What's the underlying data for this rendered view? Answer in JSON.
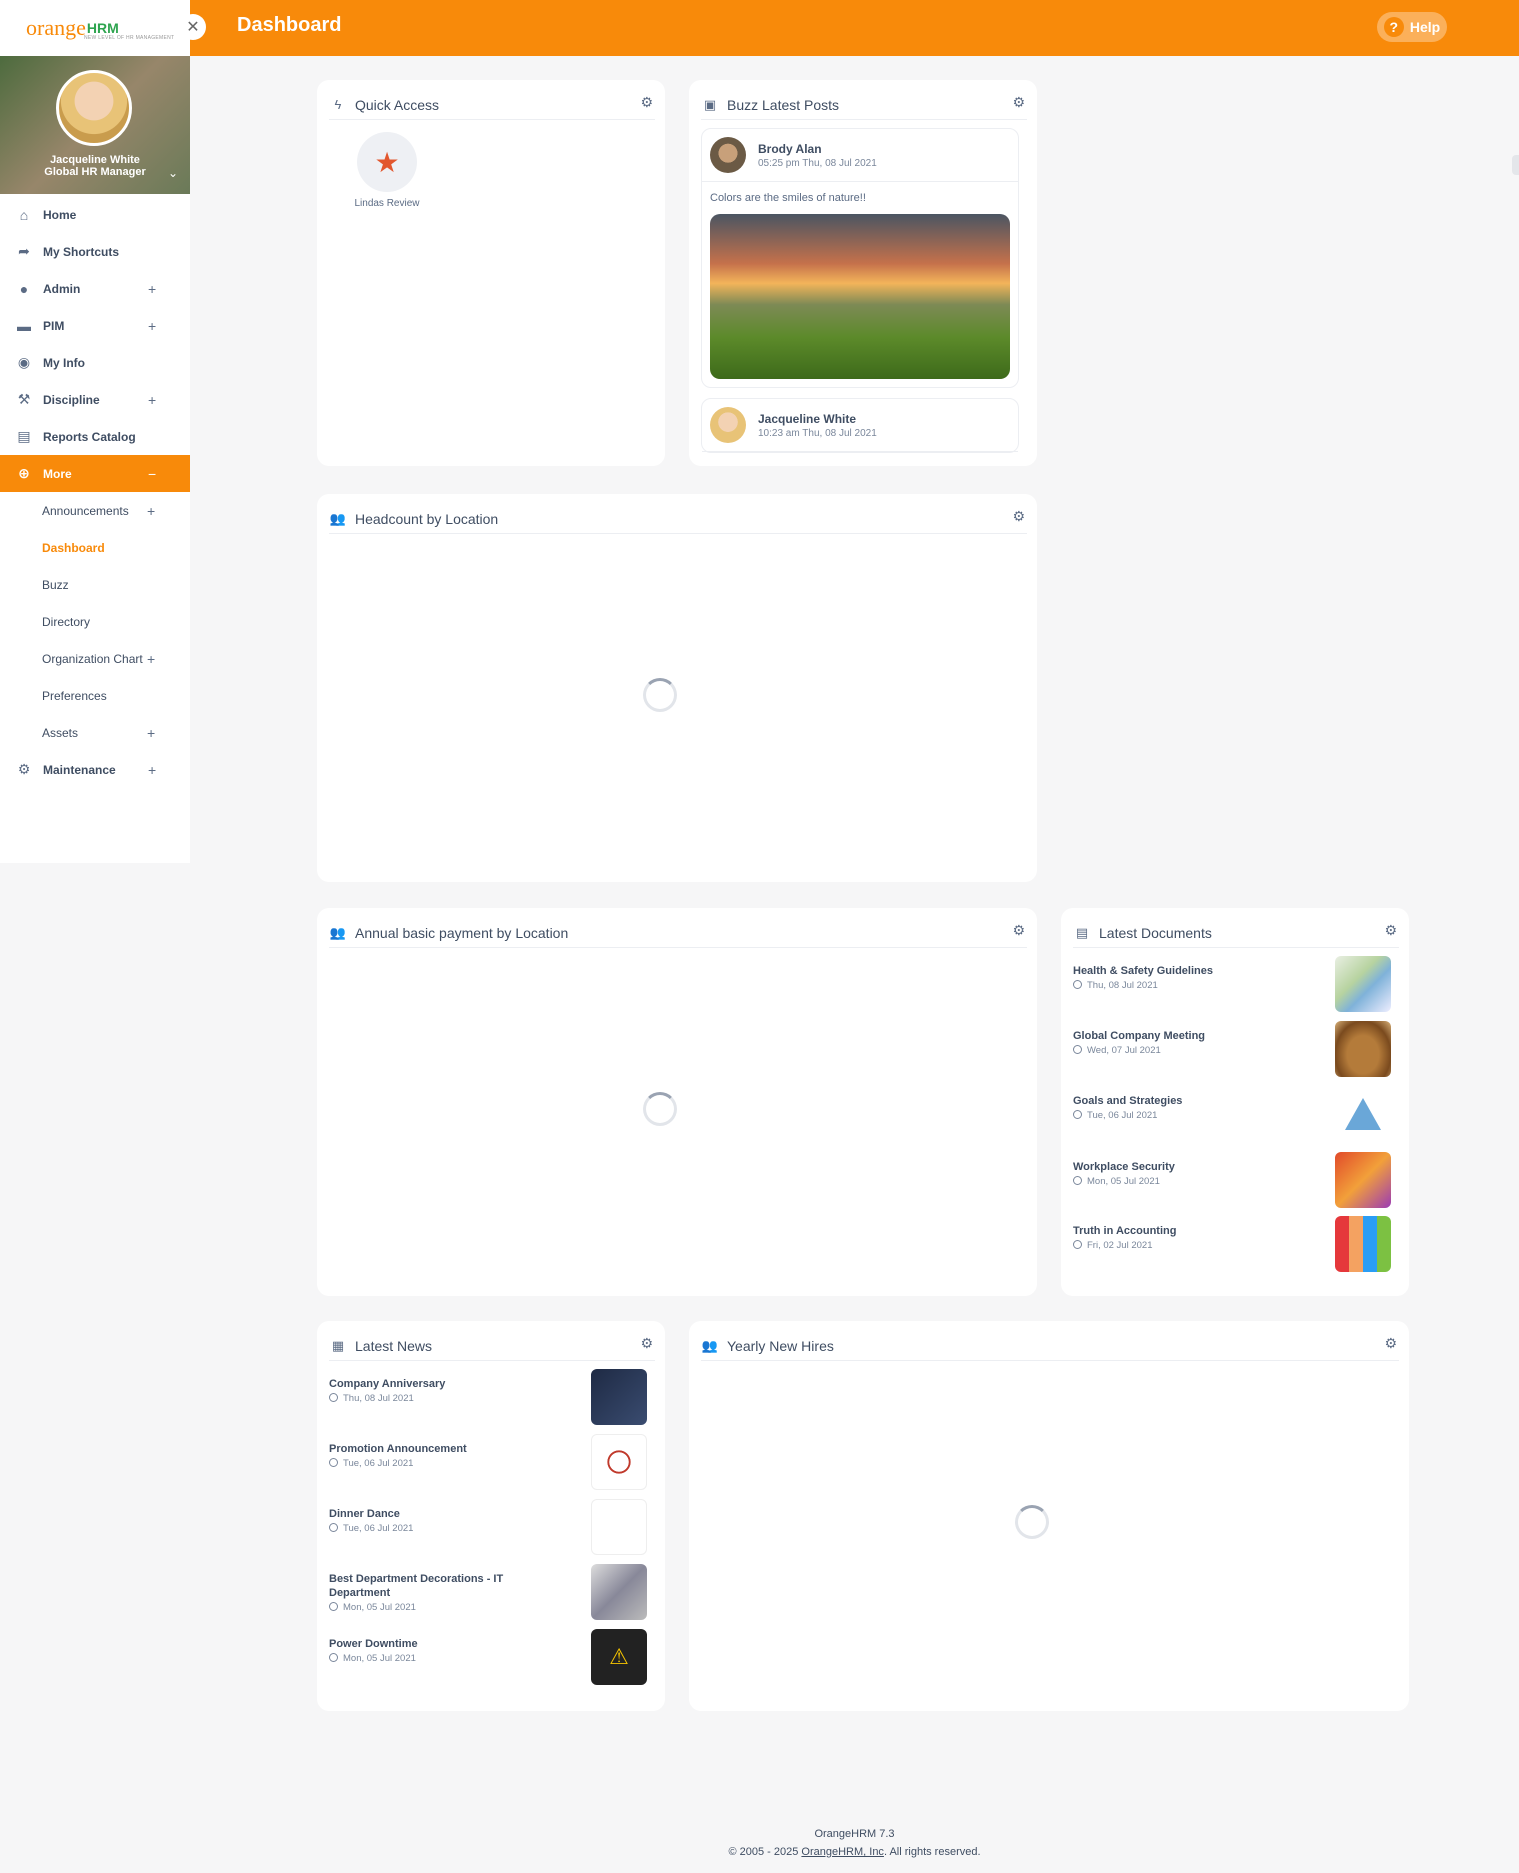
{
  "app": {
    "logo_text": "orange",
    "logo_hrm": "HRM",
    "logo_tagline": "NEW LEVEL OF HR MANAGEMENT",
    "page_title": "Dashboard",
    "help_label": "Help"
  },
  "profile": {
    "name": "Jacqueline White",
    "role": "Global HR Manager"
  },
  "nav": {
    "items": [
      {
        "label": "Home",
        "icon": "home-icon"
      },
      {
        "label": "My Shortcuts",
        "icon": "share-icon"
      },
      {
        "label": "Admin",
        "icon": "admin-icon",
        "expandable": true
      },
      {
        "label": "PIM",
        "icon": "pim-icon",
        "expandable": true
      },
      {
        "label": "My Info",
        "icon": "user-icon"
      },
      {
        "label": "Discipline",
        "icon": "discipline-icon",
        "expandable": true
      },
      {
        "label": "Reports Catalog",
        "icon": "report-icon"
      },
      {
        "label": "More",
        "icon": "more-icon",
        "expanded": true
      }
    ],
    "more_sub": [
      {
        "label": "Announcements",
        "expandable": true
      },
      {
        "label": "Dashboard",
        "current": true
      },
      {
        "label": "Buzz"
      },
      {
        "label": "Directory"
      },
      {
        "label": "Organization Chart",
        "expandable": true
      },
      {
        "label": "Preferences"
      },
      {
        "label": "Assets",
        "expandable": true
      }
    ],
    "maintenance": {
      "label": "Maintenance",
      "icon": "gear-icon",
      "expandable": true
    }
  },
  "widgets": {
    "quick_access": {
      "title": "Quick Access",
      "items": [
        {
          "label": "Lindas Review",
          "icon": "review-icon"
        }
      ]
    },
    "buzz": {
      "title": "Buzz Latest Posts",
      "posts": [
        {
          "author": "Brody Alan",
          "time": "05:25 pm Thu, 08 Jul 2021",
          "text": "Colors are the smiles of nature!!"
        },
        {
          "author": "Jacqueline White",
          "time": "10:23 am Thu, 08 Jul 2021"
        }
      ]
    },
    "headcount": {
      "title": "Headcount by Location"
    },
    "annual_payment": {
      "title": "Annual basic payment by Location"
    },
    "documents": {
      "title": "Latest Documents",
      "items": [
        {
          "title": "Health & Safety Guidelines",
          "date": "Thu, 08 Jul 2021"
        },
        {
          "title": "Global Company Meeting",
          "date": "Wed, 07 Jul 2021"
        },
        {
          "title": "Goals and Strategies",
          "date": "Tue, 06 Jul 2021"
        },
        {
          "title": "Workplace Security",
          "date": "Mon, 05 Jul 2021"
        },
        {
          "title": "Truth in Accounting",
          "date": "Fri, 02 Jul 2021"
        }
      ]
    },
    "news": {
      "title": "Latest News",
      "items": [
        {
          "title": "Company Anniversary",
          "date": "Thu, 08 Jul 2021"
        },
        {
          "title": "Promotion Announcement",
          "date": "Tue, 06 Jul 2021"
        },
        {
          "title": "Dinner Dance",
          "date": "Tue, 06 Jul 2021"
        },
        {
          "title": "Best Department Decorations - IT Department",
          "date": "Mon, 05 Jul 2021"
        },
        {
          "title": "Power Downtime",
          "date": "Mon, 05 Jul 2021"
        }
      ]
    },
    "new_hires": {
      "title": "Yearly New Hires"
    }
  },
  "footer": {
    "version": "OrangeHRM 7.3",
    "copyright_prefix": "© 2005 - 2025 ",
    "company_link": "OrangeHRM, Inc",
    "copyright_suffix": ". All rights reserved."
  },
  "colors": {
    "brand_orange": "#f88a0a",
    "text_dark": "#3f4d62",
    "text_muted": "#5b6b84"
  }
}
